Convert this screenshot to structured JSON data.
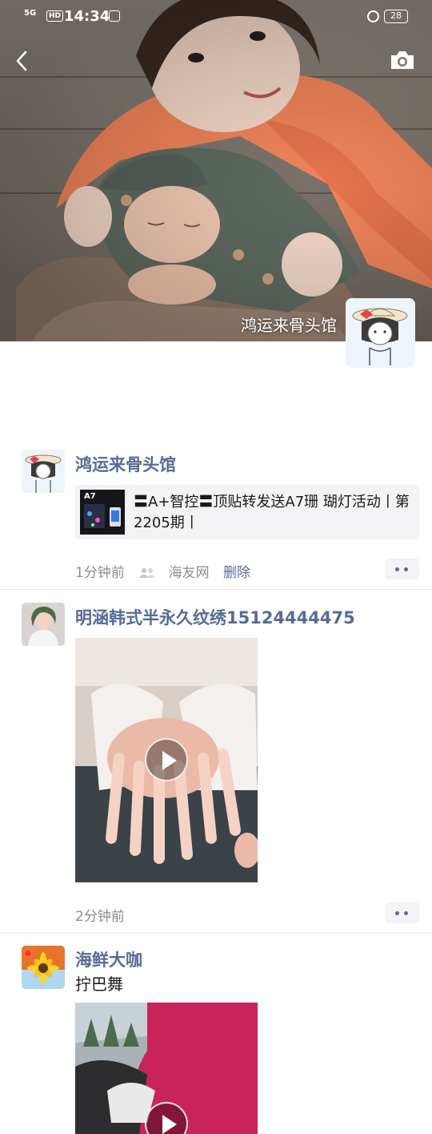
{
  "status_bar": {
    "network": "5G",
    "hd": "HD",
    "time": "14:34",
    "battery": "28"
  },
  "header": {
    "back_icon": "chevron-left-icon",
    "camera_icon": "camera-icon"
  },
  "profile": {
    "name": "鸿运来骨头馆",
    "avatar": "cartoon-girl-with-hat"
  },
  "posts": [
    {
      "author": "鸿运来骨头馆",
      "share_title": "〓A+智控〓顶贴转发送A7珊 瑚灯活动丨第2205期丨",
      "thumb_label": "A7",
      "time": "1分钟前",
      "visibility": "海友网",
      "delete": "删除"
    },
    {
      "author": "明涵韩式半永久纹绣15124444475",
      "time": "2分钟前"
    },
    {
      "author": "海鲜大咖",
      "text": "拧巴舞"
    }
  ],
  "colors": {
    "link": "#576b95",
    "meta": "#8c8c8c",
    "card_bg": "#f3f3f5"
  }
}
